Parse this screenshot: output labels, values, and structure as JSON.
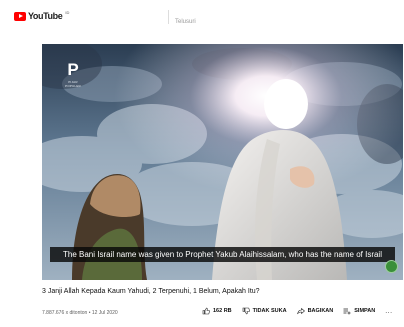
{
  "header": {
    "logo_text": "YouTube",
    "logo_sup": "ID",
    "search_placeholder": "Telusuri"
  },
  "video": {
    "channel_logo_glyph": "P",
    "channel_logo_caption": "PIJAR POPULER",
    "caption": "The Bani Israil name was given to Prophet Yakub Alaihissalam, who has the name of Israil"
  },
  "info": {
    "title": "3 Janji Allah Kepada Kaum Yahudi, 2 Terpenuhi, 1 Belum, Apakah Itu?",
    "meta": "7.887.676 x ditonton • 12 Jul 2020",
    "likes": "162 RB",
    "dislike_label": "TIDAK SUKA",
    "share_label": "BAGIKAN",
    "save_label": "SIMPAN",
    "more": "..."
  },
  "colors": {
    "brand": "#ff0000",
    "caption_bg": "#080808"
  },
  "icons": [
    "youtube-logo-icon",
    "thumbs-up-icon",
    "thumbs-down-icon",
    "share-icon",
    "save-playlist-icon",
    "more-icon"
  ]
}
